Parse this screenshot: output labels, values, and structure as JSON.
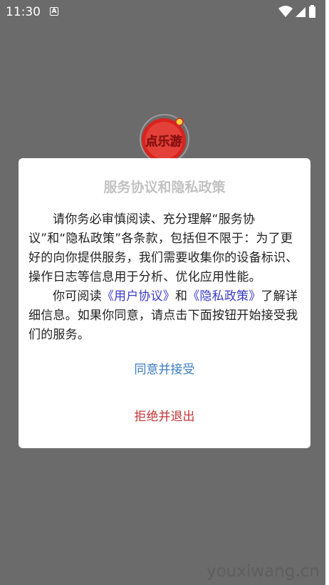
{
  "status_bar": {
    "time": "11:30",
    "notification_letter": "A",
    "icons": [
      "wifi-icon",
      "cellular-signal-icon",
      "battery-icon"
    ]
  },
  "app": {
    "logo_text": "点乐游",
    "logo_colors": {
      "ring": "#d8241f",
      "text": "#ffd23d"
    }
  },
  "dialog": {
    "title": "服务协议和隐私政策",
    "para1": "请你务必审慎阅读、充分理解“服务协议”和“隐私政策”各条款，包括但不限于：为了更好的向你提供服务，我们需要收集你的设备标识、操作日志等信息用于分析、优化应用性能。",
    "para2_prefix": "你可阅读",
    "user_agreement_link": "《用户协议》",
    "para2_and": "和",
    "privacy_policy_link": "《隐私政策》",
    "para2_suffix": "了解详细信息。如果你同意，请点击下面按钮开始接受我们的服务。",
    "agree_button": "同意并接受",
    "reject_button": "拒绝并退出"
  },
  "watermark": "youxiwang.cn",
  "colors": {
    "overlay": "#6b6b6b",
    "link": "#3b3bc6",
    "agree": "#3b7cbf",
    "reject": "#c43737",
    "title": "#c2c2c2"
  }
}
